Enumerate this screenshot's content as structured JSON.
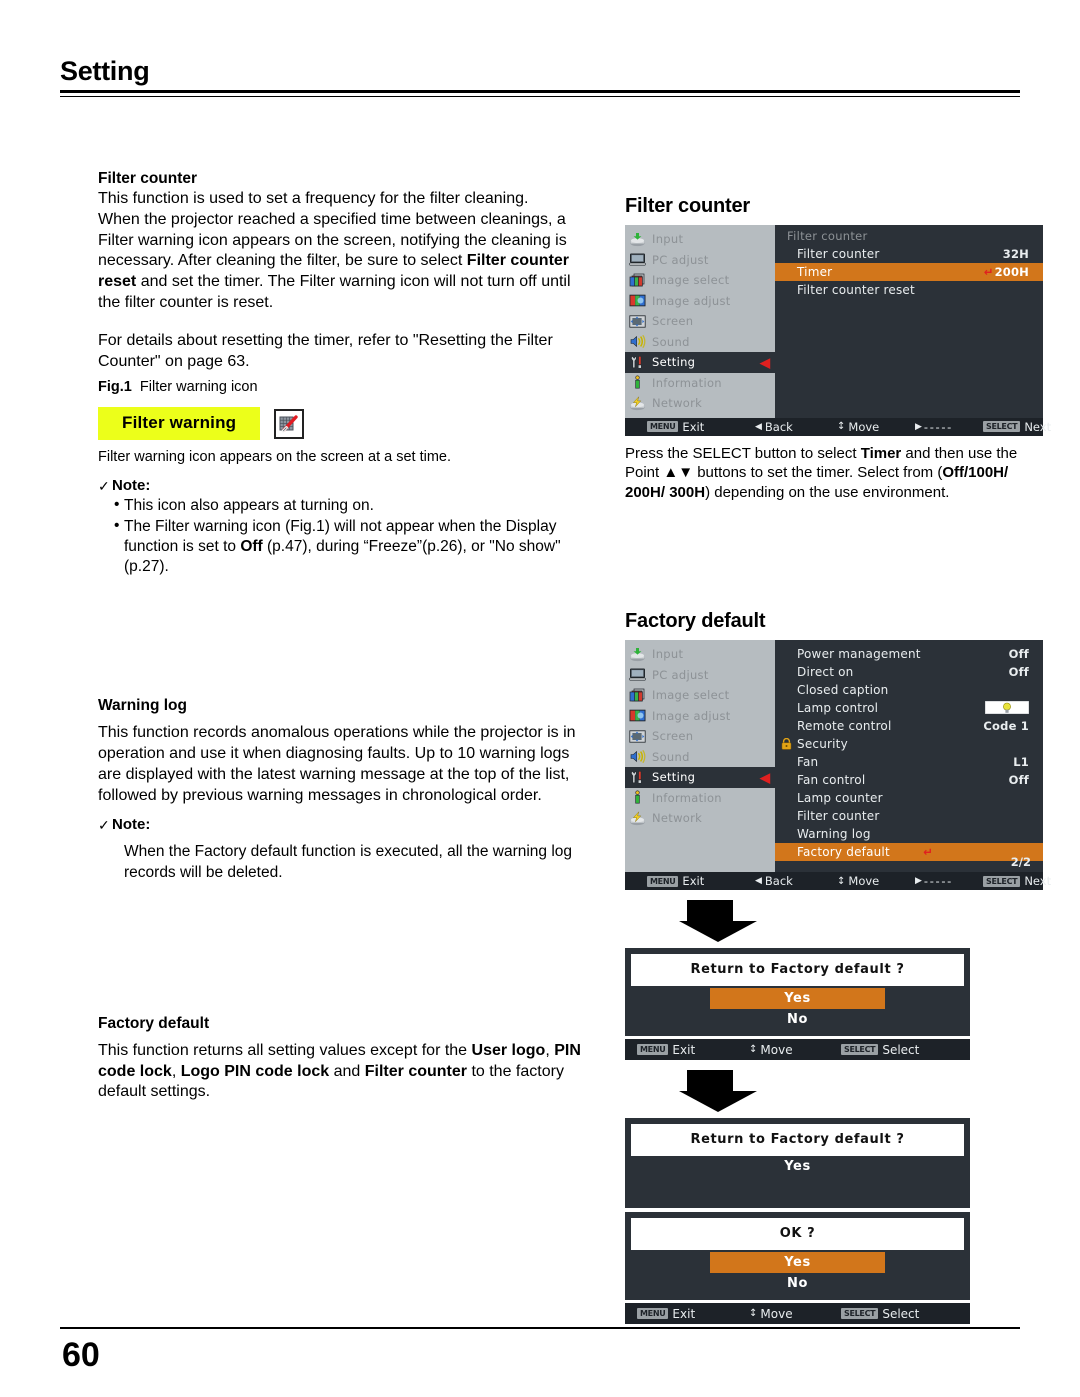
{
  "header": {
    "section_title": "Setting"
  },
  "left": {
    "filter_counter": {
      "heading": "Filter counter",
      "p1": "This function is used to set a frequency for the filter cleaning.",
      "p2_a": "When the projector reached a specified time between cleanings, a Filter warning icon appears on the screen, notifying the cleaning is necessary. After cleaning the filter, be sure to select ",
      "p2_b": "Filter counter reset",
      "p2_c": " and set the timer. The Filter warning icon will not turn off until the filter counter is reset.",
      "p3": "For details about resetting the timer, refer to \"Resetting the Filter Counter\" on page 63."
    },
    "figure": {
      "fig_label": "Fig.1",
      "fig_caption": "Filter warning icon",
      "badge_text": "Filter warning",
      "badge_icon": "filter-brush-icon",
      "badge_bg": "#ecff1a",
      "below_caption": "Filter warning icon appears on the screen at a set time."
    },
    "note1": {
      "check": "✓",
      "title": "Note:",
      "bullet": "•",
      "items": [
        "This icon also appears at turning on."
      ],
      "item2_a": "The Filter warning icon (Fig.1) will not appear when the Display function is set to ",
      "item2_b": "Off",
      "item2_c": " (p.47), during “Freeze”(p.26), or \"No show\" (p.27)."
    },
    "warning_log": {
      "heading": "Warning log",
      "p1": "This function records anomalous operations while the projector is in operation and use it when diagnosing faults. Up to 10 warning logs are displayed with the latest warning message at the top of the list, followed by previous warning messages in chronological order.",
      "note_check": "✓",
      "note_title": "Note:",
      "note_body": "When the Factory default function is executed, all the warning log records will be deleted."
    },
    "factory_default": {
      "heading": "Factory default",
      "p_a": "This function returns all setting values except for the ",
      "p_b": "User logo",
      "p_c": ", ",
      "p_d": "PIN code lock",
      "p_e": ", ",
      "p_f": "Logo PIN code lock",
      "p_g": " and ",
      "p_h": "Filter counter",
      "p_i": " to the factory default settings."
    }
  },
  "right": {
    "osd1": {
      "title": "Filter counter",
      "sidebar": [
        {
          "label": "Input",
          "icon": "input-icon",
          "selected": false
        },
        {
          "label": "PC adjust",
          "icon": "monitor-icon",
          "selected": false
        },
        {
          "label": "Image select",
          "icon": "image-select-icon",
          "selected": false
        },
        {
          "label": "Image adjust",
          "icon": "image-adjust-icon",
          "selected": false
        },
        {
          "label": "Screen",
          "icon": "screen-icon",
          "selected": false
        },
        {
          "label": "Sound",
          "icon": "speaker-icon",
          "selected": false
        },
        {
          "label": "Setting",
          "icon": "wrench-icon",
          "selected": true,
          "arrow": "◀"
        },
        {
          "label": "Information",
          "icon": "info-icon",
          "selected": false
        },
        {
          "label": "Network",
          "icon": "network-icon",
          "selected": false
        }
      ],
      "panel_header": "Filter counter",
      "rows": [
        {
          "label": "Filter counter",
          "value": "32H",
          "highlight": false,
          "enter": ""
        },
        {
          "label": "Timer",
          "value": "200H",
          "highlight": true,
          "enter": "↵"
        },
        {
          "label": "Filter counter reset",
          "value": "",
          "highlight": false,
          "enter": ""
        }
      ],
      "statusbar": {
        "menu_key": "MENU",
        "exit": "Exit",
        "back_arrow": "◀",
        "back": "Back",
        "move_arrow": "↕",
        "move": "Move",
        "dash_arrow": "▶",
        "dashes": "- - - - -",
        "select_key": "SELECT",
        "next": "Next"
      },
      "caption_a": "Press the SELECT button to select  ",
      "caption_b": "Timer",
      "caption_c": " and then use the Point ▲▼ buttons to set the timer. Select from (",
      "caption_d": "Off/100H/ 200H/ 300H",
      "caption_e": ") depending on the use environment."
    },
    "osd2": {
      "title": "Factory default",
      "sidebar": [
        {
          "label": "Input",
          "icon": "input-icon",
          "selected": false
        },
        {
          "label": "PC adjust",
          "icon": "monitor-icon",
          "selected": false
        },
        {
          "label": "Image select",
          "icon": "image-select-icon",
          "selected": false
        },
        {
          "label": "Image adjust",
          "icon": "image-adjust-icon",
          "selected": false
        },
        {
          "label": "Screen",
          "icon": "screen-icon",
          "selected": false
        },
        {
          "label": "Sound",
          "icon": "speaker-icon",
          "selected": false
        },
        {
          "label": "Setting",
          "icon": "wrench-icon",
          "selected": true,
          "arrow": "◀"
        },
        {
          "label": "Information",
          "icon": "info-icon",
          "selected": false
        },
        {
          "label": "Network",
          "icon": "network-icon",
          "selected": false
        }
      ],
      "rows": [
        {
          "label": "Power management",
          "value": "Off",
          "highlight": false,
          "icon": ""
        },
        {
          "label": "Direct on",
          "value": "Off",
          "highlight": false,
          "icon": ""
        },
        {
          "label": "Closed caption",
          "value": "",
          "highlight": false,
          "icon": ""
        },
        {
          "label": "Lamp control",
          "value": "",
          "highlight": false,
          "icon": "lamp-swatch-icon"
        },
        {
          "label": "Remote control",
          "value": "Code 1",
          "highlight": false,
          "icon": ""
        },
        {
          "label": "Security",
          "value": "",
          "highlight": false,
          "icon": "lock-icon"
        },
        {
          "label": "Fan",
          "value": "L1",
          "highlight": false,
          "icon": ""
        },
        {
          "label": "Fan control",
          "value": "Off",
          "highlight": false,
          "icon": ""
        },
        {
          "label": "Lamp counter",
          "value": "",
          "highlight": false,
          "icon": ""
        },
        {
          "label": "Filter counter",
          "value": "",
          "highlight": false,
          "icon": ""
        },
        {
          "label": "Warning log",
          "value": "",
          "highlight": false,
          "icon": ""
        },
        {
          "label": "Factory default",
          "value": "↵",
          "highlight": true,
          "icon": ""
        }
      ],
      "page_indicator": "2/2",
      "statusbar": {
        "menu_key": "MENU",
        "exit": "Exit",
        "back_arrow": "◀",
        "back": "Back",
        "move_arrow": "↕",
        "move": "Move",
        "dash_arrow": "▶",
        "dashes": "- - - - -",
        "select_key": "SELECT",
        "next": "Next"
      }
    },
    "dialog1": {
      "prompt": "Return to Factory default ?",
      "yes": "Yes",
      "no": "No",
      "statusbar": {
        "menu_key": "MENU",
        "exit": "Exit",
        "move_arrow": "↕",
        "move": "Move",
        "select_key": "SELECT",
        "select": "Select"
      }
    },
    "dialog2a": {
      "prompt": "Return to Factory default ?",
      "yes": "Yes"
    },
    "dialog2b": {
      "prompt": "OK ?",
      "yes": "Yes",
      "no": "No",
      "statusbar": {
        "menu_key": "MENU",
        "exit": "Exit",
        "move_arrow": "↕",
        "move": "Move",
        "select_key": "SELECT",
        "select": "Select"
      }
    }
  },
  "footer": {
    "page_number": "60"
  },
  "colors": {
    "highlight_orange": "#d2761b",
    "osd_dark": "#2b3138",
    "osd_bar": "#1d2228",
    "sidebar_grey": "#b6bcc0",
    "warning_yellow": "#ecff1a",
    "red_accent": "#e02020"
  }
}
